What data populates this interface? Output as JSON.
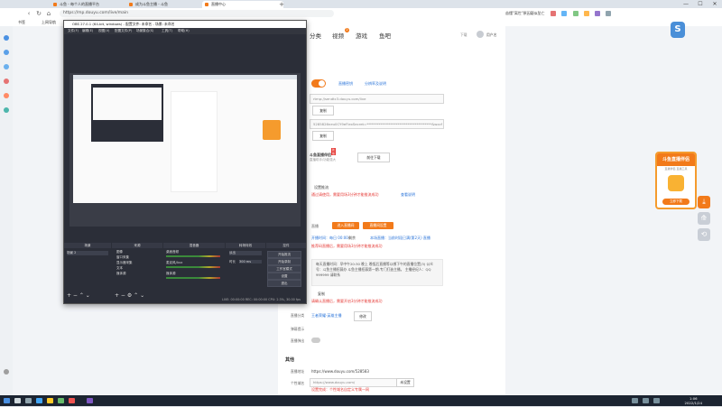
{
  "browser": {
    "tabs": [
      {
        "label": "斗鱼 - 每个人的直播平台"
      },
      {
        "label": "成为斗鱼主播 - 斗鱼"
      },
      {
        "label": "直播中心"
      }
    ],
    "address": "https://mp.douyu.com/live/main",
    "search_placeholder": "苗懂\"离世\"原因疑似坠亡",
    "bookmarks": [
      "书签",
      "上网导航"
    ],
    "window_controls": [
      "—",
      "☐",
      "✕"
    ]
  },
  "header": {
    "nav": [
      {
        "label": "分类"
      },
      {
        "label": "视频"
      },
      {
        "label": "游戏"
      },
      {
        "label": "鱼吧"
      }
    ],
    "badge": "2",
    "upload": "下载",
    "user": "用户名"
  },
  "stream": {
    "server_value": "rtmp://sendtc3.douyu.com/live",
    "server_links": [
      "直播密钥",
      "分辨率及说明"
    ],
    "copy_label": "复制",
    "key_value": "5285826neu0CY9eFlexSecret=**************************************&wxcf",
    "downloader_title": "斗鱼直播伴侣",
    "downloader_sub": "直播助手/功能强大",
    "download_label": "前往下载",
    "badge_new": "新版",
    "notice_label": "设置推流",
    "warning1": "通过请使用，需要用场3分钟才能推流成功",
    "warning1_link": "查看说明",
    "section_label": "直播",
    "orange_btn1": "进入直播间",
    "orange_btn2": "直播间设置",
    "schedule_row": "开播时间：每日 00:00",
    "schedule_mid": "剩余",
    "schedule_right": "本场直播：当前时段已满(第2天) 直播",
    "warning2": "推荐码直播后，需要用场3分钟才能推流成功",
    "notice_text": "每天直播时间：早中午20:30 晚上 晚饭后直播等以哪下午的直播位置(3) 公众号：斗鱼主播招募办 斗鱼主播招募第一期-专门打造主播。 主播经纪人：QQ 999999 请联系",
    "copy2": "复制",
    "warning3": "请确认直播后，需要开启3分钟才能推流成功",
    "category_label": "直播分类",
    "category_value": "王者荣耀-英雄主播",
    "modify": "修改",
    "hint_label": "弹幕提示",
    "gift_label": "直播弹出",
    "other_title": "其他",
    "room_label": "直播地址",
    "room_value": "https://www.douyu.com/528583",
    "share_label": "个性域名",
    "share_value": "https://www.douyu.com/",
    "share_select": "未设置",
    "share_warn": "设置完成：个性域名自定义专属一网"
  },
  "promo": {
    "title": "斗鱼直播伴侣",
    "sub": "直播伴侣 直播工具",
    "cta": "立即下载"
  },
  "float_buttons": [
    "⤓",
    "⟰",
    "⟲"
  ],
  "obs": {
    "title": "OBS 27.0.1 (64-bit, windows) - 配置文件: 未命名 - 场景: 未命名",
    "menu": [
      "文件(F)",
      "编辑(E)",
      "视图(V)",
      "配置文件(P)",
      "场景集合(S)",
      "工具(T)",
      "帮助(H)"
    ],
    "dock_headers": [
      "场景",
      "来源",
      "混音器",
      "转场特效",
      "控件"
    ],
    "scene_item": "场景 2",
    "sources": [
      "图像",
      "窗口采集",
      "显示器采集",
      "文本",
      "媒体源"
    ],
    "mixer": [
      "桌面音频",
      "麦克风/Aux",
      "媒体源"
    ],
    "transition": "淡出",
    "duration_label": "时长",
    "duration_value": "300 ms",
    "controls": [
      "开始推流",
      "开始录制",
      "工作室模式",
      "设置",
      "退出"
    ],
    "status": "LIVE: 00:00:00   REC: 00:00:00   CPU: 2.3%, 30.00 fps"
  },
  "taskbar": {
    "time": "1:06",
    "date": "2022/1/24"
  },
  "colors": {
    "accent": "#f27a1a",
    "link": "#2a74d9",
    "warning": "#e53935",
    "obs_bg": "#2b2e38"
  }
}
